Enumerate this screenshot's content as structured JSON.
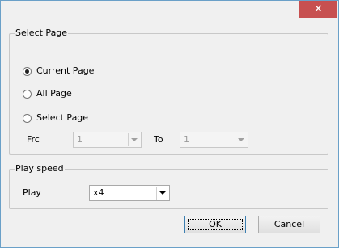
{
  "titlebar": {
    "close_glyph": "✕"
  },
  "select_page": {
    "legend": "Select Page",
    "options": [
      {
        "label": "Current Page",
        "checked": true
      },
      {
        "label": "All Page",
        "checked": false
      },
      {
        "label": "Select Page",
        "checked": false
      }
    ],
    "from_label": "Frc",
    "from_value": "1",
    "to_label": "To",
    "to_value": "1"
  },
  "play_speed": {
    "legend": "Play speed",
    "play_label": "Play",
    "play_value": "x4"
  },
  "buttons": {
    "ok": "OK",
    "cancel": "Cancel"
  },
  "colors": {
    "close_bg": "#c75050",
    "window_border": "#6aa0c8",
    "dialog_bg": "#f0f0f0"
  }
}
